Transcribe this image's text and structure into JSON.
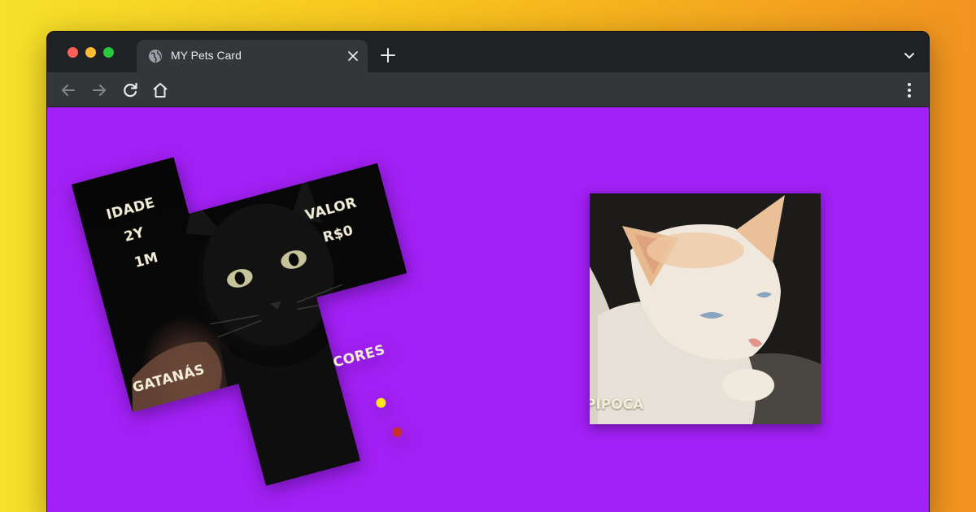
{
  "browser": {
    "tab_title": "MY Pets Card"
  },
  "card_cat1": {
    "age_label": "IDADE",
    "age_years": "2Y",
    "age_months": "1M",
    "value_label": "VALOR",
    "value_amount": "R$0",
    "colors_label": "CORES",
    "name": "GATANÁS",
    "color_swatches": [
      "#ffe81a",
      "#c8302c"
    ]
  },
  "card_cat2": {
    "name": "PIPOCA"
  },
  "colors": {
    "page_background": "#a21ff5",
    "label_text": "#f3eed8"
  }
}
